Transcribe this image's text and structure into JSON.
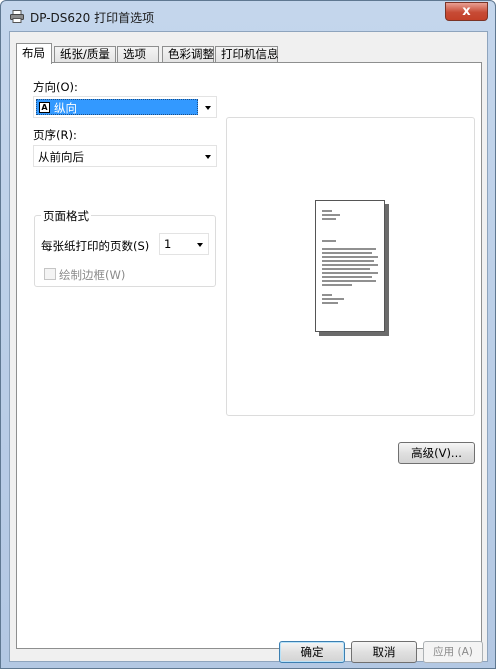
{
  "window": {
    "title": "DP-DS620 打印首选项",
    "close_label": "x"
  },
  "tabs": [
    {
      "label": "布局"
    },
    {
      "label": "纸张/质量"
    },
    {
      "label": "选项"
    },
    {
      "label": "色彩调整"
    },
    {
      "label": "打印机信息"
    }
  ],
  "layout": {
    "orientation_label": "方向(O):",
    "orientation_icon_glyph": "A",
    "orientation_value": "纵向",
    "page_order_label": "页序(R):",
    "page_order_value": "从前向后",
    "page_format_title": "页面格式",
    "pages_per_sheet_label": "每张纸打印的页数(S)",
    "pages_per_sheet_value": "1",
    "draw_borders_label": "绘制边框(W)",
    "draw_borders_checked": false
  },
  "advanced_button": "高级(V)...",
  "footer": {
    "ok": "确定",
    "cancel": "取消",
    "apply": "应用 (A)"
  },
  "icons": {
    "title": "printer-icon",
    "orientation": "portrait-page-icon"
  },
  "colors": {
    "selection": "#3399ff",
    "titlebar": "#c4d6ec",
    "close": "#c74b35"
  }
}
